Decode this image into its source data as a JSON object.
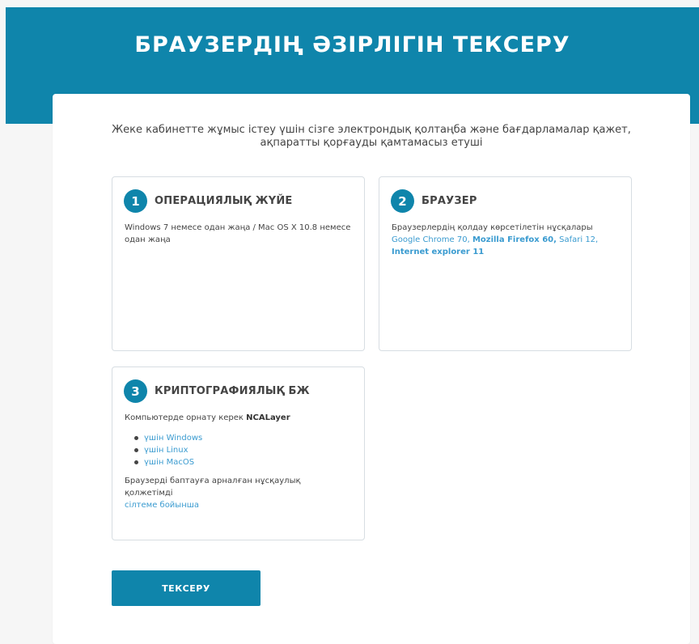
{
  "header": {
    "title": "БРАУЗЕРДІҢ ӘЗІРЛІГІН ТЕКСЕРУ"
  },
  "intro": {
    "line1": "Жеке кабинетте жұмыс істеу үшін сізге электрондық қолтаңба және бағдарламалар қажет,",
    "line2": "ақпаратты қорғауды қамтамасыз етуші"
  },
  "sections": {
    "os": {
      "number": "1",
      "title": "ОПЕРАЦИЯЛЫҚ ЖҮЙЕ",
      "text": "Windows 7 немесе одан жаңа / Mac OS X 10.8 немесе одан жаңа"
    },
    "browser": {
      "number": "2",
      "title": "БРАУЗЕР",
      "text": "Браузерлердің қолдау көрсетілетін нұсқалары",
      "browsers": [
        {
          "label": "Google Chrome 70,",
          "bold": false
        },
        {
          "label": "Mozilla Firefox 60,",
          "bold": true
        },
        {
          "label": "Safari 12,",
          "bold": false
        },
        {
          "label": "Internet explorer 11",
          "bold": true
        }
      ]
    },
    "crypto": {
      "number": "3",
      "title": "КРИПТОГРАФИЯЛЫҚ БЖ",
      "text": "Компьютерде орнату керек",
      "product": "NCALayer",
      "downloads": [
        {
          "label": "үшін Windows"
        },
        {
          "label": "үшін Linux"
        },
        {
          "label": "үшін MacOS"
        }
      ],
      "setup_text": "Браузерді баптауға арналған нұсқаулық қолжетімді",
      "setup_link": "сілтеме бойынша"
    }
  },
  "actions": {
    "check_label": "ТЕКСЕРУ"
  },
  "colors": {
    "primary": "#0f85ab",
    "link": "#3a9bd0",
    "background": "#f6f6f6"
  }
}
